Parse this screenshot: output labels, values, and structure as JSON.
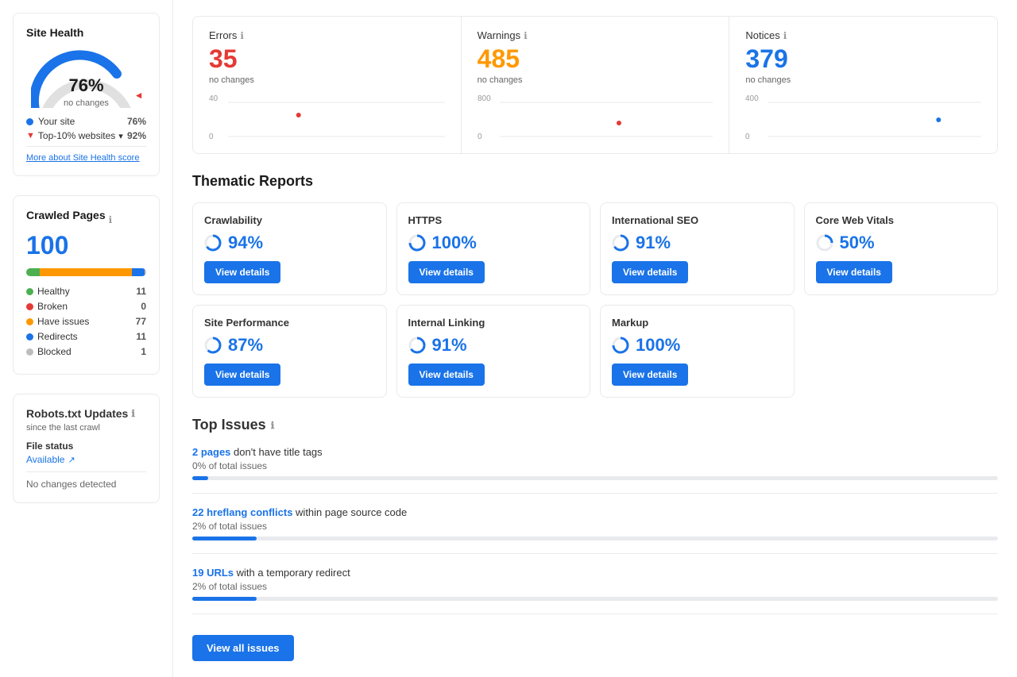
{
  "sidebar": {
    "site_health": {
      "title": "Site Health",
      "gauge_percent": "76%",
      "gauge_label": "no changes",
      "your_site_label": "Your site",
      "your_site_value": "76%",
      "top10_label": "Top-10% websites",
      "top10_value": "92%",
      "more_link": "More about Site Health score"
    },
    "crawled_pages": {
      "title": "Crawled Pages",
      "info_icon": "ℹ",
      "count": "100",
      "legend": [
        {
          "label": "Healthy",
          "count": "11",
          "color": "#4caf50"
        },
        {
          "label": "Broken",
          "count": "0",
          "color": "#e53935"
        },
        {
          "label": "Have issues",
          "count": "77",
          "color": "#ff9800"
        },
        {
          "label": "Redirects",
          "count": "11",
          "color": "#1a73e8"
        },
        {
          "label": "Blocked",
          "count": "1",
          "color": "#bdbdbd"
        }
      ]
    },
    "robots": {
      "title": "Robots.txt Updates",
      "info_icon": "ℹ",
      "subtitle": "since the last crawl",
      "file_status_label": "File status",
      "file_status_value": "Available",
      "no_changes": "No changes detected"
    }
  },
  "metrics": [
    {
      "title": "Errors",
      "info_icon": "ℹ",
      "value": "35",
      "value_color": "#e53935",
      "change": "no changes",
      "chart_max": 40,
      "chart_min": 0,
      "dot_x": 0.32,
      "dot_y": 0.28
    },
    {
      "title": "Warnings",
      "info_icon": "ℹ",
      "value": "485",
      "value_color": "#ff9800",
      "change": "no changes",
      "chart_max": 800,
      "chart_min": 0,
      "dot_x": 0.6,
      "dot_y": 0.55
    },
    {
      "title": "Notices",
      "info_icon": "ℹ",
      "value": "379",
      "value_color": "#1a73e8",
      "change": "no changes",
      "chart_max": 400,
      "chart_min": 0,
      "dot_x": 0.82,
      "dot_y": 0.48
    }
  ],
  "thematic_reports": {
    "title": "Thematic Reports",
    "reports": [
      {
        "name": "Crawlability",
        "score": "94%",
        "btn": "View details"
      },
      {
        "name": "HTTPS",
        "score": "100%",
        "btn": "View details"
      },
      {
        "name": "International SEO",
        "score": "91%",
        "btn": "View details"
      },
      {
        "name": "Core Web Vitals",
        "score": "50%",
        "btn": "View details"
      },
      {
        "name": "Site Performance",
        "score": "87%",
        "btn": "View details"
      },
      {
        "name": "Internal Linking",
        "score": "91%",
        "btn": "View details"
      },
      {
        "name": "Markup",
        "score": "100%",
        "btn": "View details"
      }
    ]
  },
  "top_issues": {
    "title": "Top Issues",
    "info_icon": "ℹ",
    "issues": [
      {
        "link_text": "2 pages",
        "text": "don't have title tags",
        "pct": "0% of total issues",
        "bar_pct": 2
      },
      {
        "link_text": "22 hreflang conflicts",
        "text": "within page source code",
        "pct": "2% of total issues",
        "bar_pct": 8
      },
      {
        "link_text": "19 URLs",
        "text": "with a temporary redirect",
        "pct": "2% of total issues",
        "bar_pct": 8
      }
    ],
    "view_all_btn": "View all issues"
  }
}
